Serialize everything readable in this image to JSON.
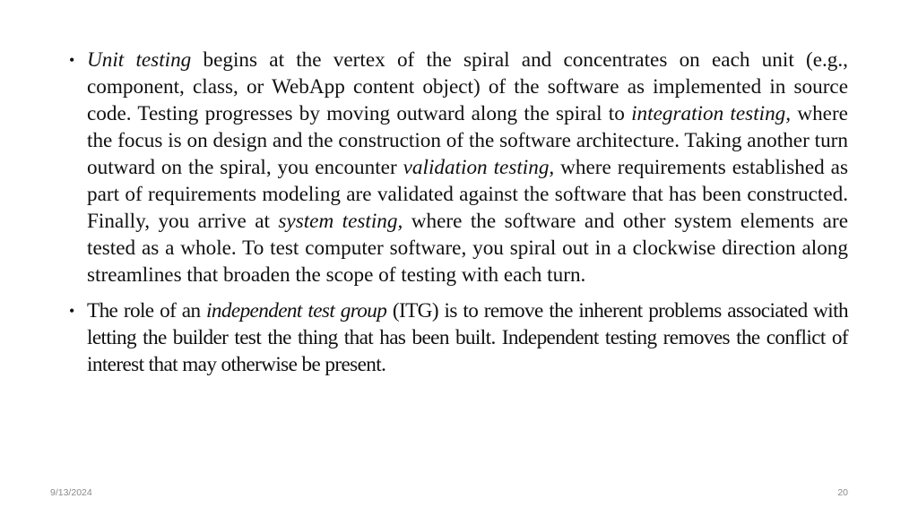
{
  "slide": {
    "bullets": [
      {
        "segments": [
          {
            "text": "Unit testing",
            "italic": true
          },
          {
            "text": " begins at the vertex of the spiral and concentrates on each unit (e.g., component, class, or WebApp content object) of the software as implemented in source code. Testing progresses by moving outward along the spiral to ",
            "italic": false
          },
          {
            "text": "integration testing,",
            "italic": true
          },
          {
            "text": " where the focus is on design and the construction of the software architecture. Taking another turn outward on the spiral, you encounter ",
            "italic": false
          },
          {
            "text": "validation testing,",
            "italic": true
          },
          {
            "text": " where requirements established as part of requirements modeling are validated against the software that has been constructed. Finally, you arrive at ",
            "italic": false
          },
          {
            "text": "system testing,",
            "italic": true
          },
          {
            "text": " where the software and other system elements are tested as a whole. To test computer software, you spiral out in a clockwise direction along streamlines that broaden the scope of testing with each turn.",
            "italic": false
          }
        ]
      },
      {
        "segments": [
          {
            "text": "The role of an ",
            "italic": false
          },
          {
            "text": "independent test group",
            "italic": true
          },
          {
            "text": " (ITG) is to remove the inherent problems associated with letting the builder test the thing that has been built. Independent testing removes the conflict of interest that may otherwise be present.",
            "italic": false
          }
        ]
      }
    ],
    "bullet_glyph": "•"
  },
  "footer": {
    "date": "9/13/2024",
    "page_number": "20"
  }
}
